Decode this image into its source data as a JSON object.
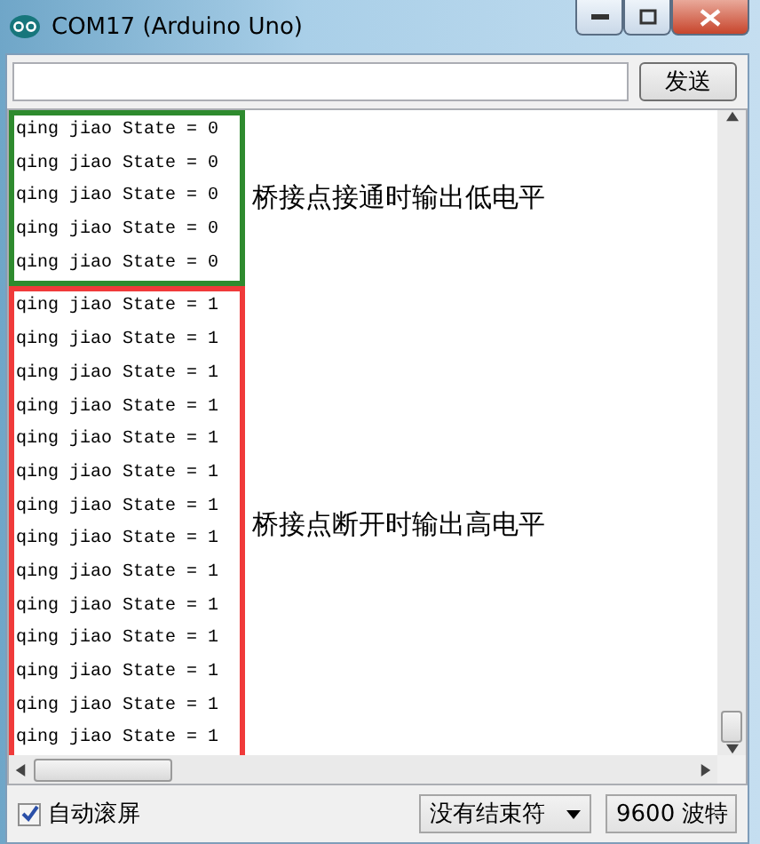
{
  "window": {
    "title": "COM17 (Arduino Uno)"
  },
  "send": {
    "button": "发送"
  },
  "output": {
    "groups": [
      {
        "color": "#2e8b2e",
        "note": "桥接点接通时输出低电平",
        "lines": [
          "qing jiao State = 0",
          "qing jiao State = 0",
          "qing jiao State = 0",
          "qing jiao State = 0",
          "qing jiao State = 0"
        ]
      },
      {
        "color": "#f03a3a",
        "note": "桥接点断开时输出高电平",
        "lines": [
          "qing jiao State = 1",
          "qing jiao State = 1",
          "qing jiao State = 1",
          "qing jiao State = 1",
          "qing jiao State = 1",
          "qing jiao State = 1",
          "qing jiao State = 1",
          "qing jiao State = 1",
          "qing jiao State = 1",
          "qing jiao State = 1",
          "qing jiao State = 1",
          "qing jiao State = 1",
          "qing jiao State = 1",
          "qing jiao State = 1"
        ]
      }
    ]
  },
  "autoscroll": {
    "label": "自动滚屏",
    "checked": true
  },
  "line_ending": {
    "value": "没有结束符"
  },
  "baud": {
    "value": "9600 波特"
  }
}
